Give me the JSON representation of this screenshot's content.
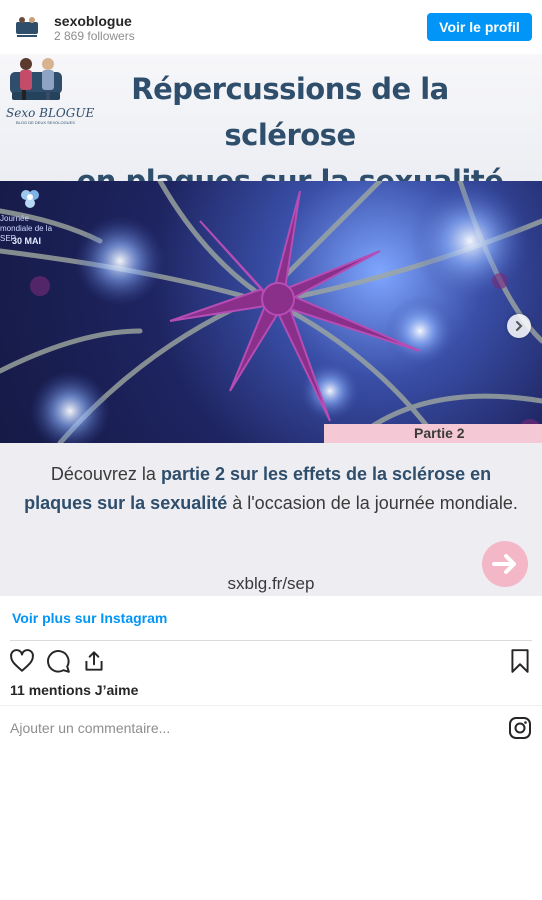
{
  "header": {
    "username": "sexoblogue",
    "followers": "2 869 followers",
    "profile_button": "Voir le profil"
  },
  "post": {
    "logo_text": "Sexo BLOGUE",
    "logo_subtitle": "BLOG DE DEUX SEXOLOGUES",
    "title_line1": "Répercussions de la sclérose",
    "title_line2": "en plaques sur la sexualité",
    "event_text": "Journée mondiale de la SEP",
    "event_date": "30 MAI",
    "part_label": "Partie 2",
    "desc_prefix": "Découvrez la ",
    "desc_bold1": "partie 2 sur les effets de la sclérose en plaques sur  la sexualité",
    "desc_suffix": " à l'occasion de la journée mondiale.",
    "url": "sxblg.fr/sep"
  },
  "footer": {
    "more_link": "Voir plus sur Instagram",
    "likes": "11 mentions J’aime",
    "comment_placeholder": "Ajouter un commentaire..."
  },
  "icons": [
    "heart-icon",
    "comment-icon",
    "share-icon",
    "bookmark-icon",
    "instagram-icon",
    "chevron-right-icon",
    "arrow-right-icon"
  ],
  "colors": {
    "accent": "#0095f6",
    "title": "#2e4e6c",
    "pink": "#f4c9d5"
  }
}
